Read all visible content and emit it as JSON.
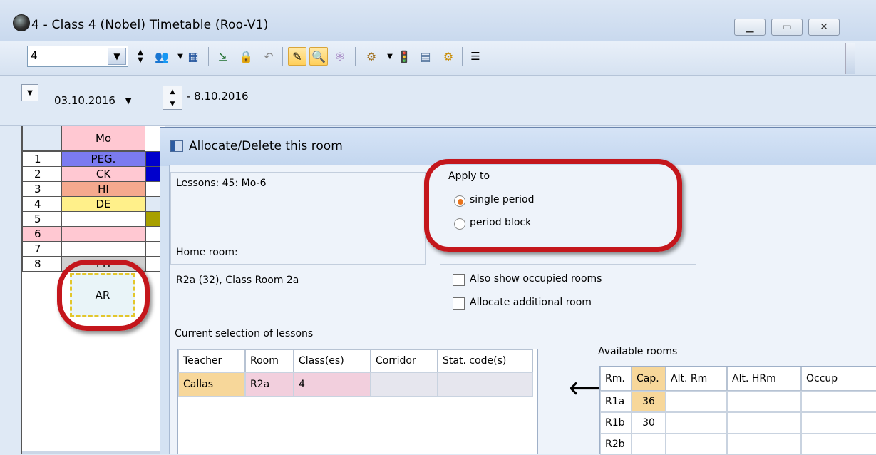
{
  "window": {
    "title": "4 - Class 4 (Nobel)  Timetable  (Roo-V1)"
  },
  "toolbar": {
    "class_value": "4"
  },
  "datebar": {
    "start_date": "03.10.2016",
    "end_date": "- 8.10.2016"
  },
  "timetable": {
    "day_header": "Mo",
    "rows": [
      {
        "num": "1",
        "subject": "PEG.",
        "color": "#7b7bf0",
        "side": "#0000cc"
      },
      {
        "num": "2",
        "subject": "CK",
        "color": "#ffc8d2",
        "side": "#0000cc"
      },
      {
        "num": "3",
        "subject": "HI",
        "color": "#f5a98e",
        "side": "#ffffff"
      },
      {
        "num": "4",
        "subject": "DE",
        "color": "#fff08a",
        "side": "#dfe9f5"
      },
      {
        "num": "5",
        "subject": "",
        "color": "#ffffff",
        "side": "#a8a000"
      },
      {
        "num": "6",
        "subject": "",
        "color": "#ffc8d2",
        "side": "#ffffff"
      },
      {
        "num": "7",
        "subject": "",
        "color": "#ffffff",
        "side": "#ffffff"
      },
      {
        "num": "8",
        "subject": "PH",
        "color": "#d0d0d0",
        "side": "#ffffff"
      }
    ],
    "selected_lesson": "AR"
  },
  "dialog": {
    "title": "Allocate/Delete this room",
    "lessons_label": "Lessons: 45: Mo-6",
    "home_room_label": "Home room:",
    "home_room_value": "R2a (32), Class Room 2a",
    "apply_to_label": "Apply to",
    "apply_single": "single period",
    "apply_block": "period block",
    "also_show_occupied": "Also show occupied rooms",
    "allocate_additional": "Allocate additional room",
    "current_selection_label": "Current selection of lessons",
    "lesson_headers": [
      "Teacher",
      "Room",
      "Class(es)",
      "Corridor",
      "Stat. code(s)"
    ],
    "lesson_row": [
      "Callas",
      "R2a",
      "4",
      "",
      ""
    ],
    "available_rooms_label": "Available rooms",
    "room_headers": [
      "Rm.",
      "Cap.",
      "Alt. Rm",
      "Alt. HRm",
      "Occup"
    ],
    "rooms": [
      {
        "rm": "R1a",
        "cap": "36"
      },
      {
        "rm": "R1b",
        "cap": "30"
      },
      {
        "rm": "R2b",
        "cap": ""
      }
    ],
    "arrow": "🡐"
  }
}
